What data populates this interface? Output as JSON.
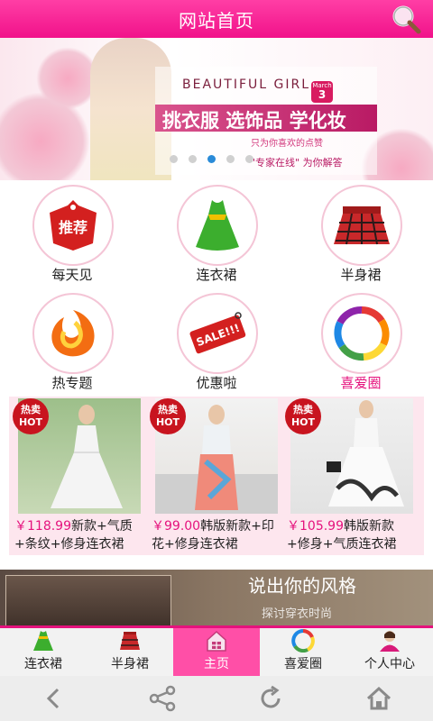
{
  "header": {
    "title": "网站首页",
    "search_icon": "search-icon"
  },
  "banner": {
    "heading": "BEAUTIFUL GIRL",
    "slogan": "挑衣服 选饰品 学化妆",
    "sub1": "只为你喜欢的点赞",
    "sub2": "\"专家在线\" 为你解答",
    "month": "March",
    "day": "3",
    "active_dot": 2
  },
  "categories": [
    {
      "label": "每天见",
      "icon": "recommend-tag-icon",
      "badge": "推荐"
    },
    {
      "label": "连衣裙",
      "icon": "dress-icon"
    },
    {
      "label": "半身裙",
      "icon": "skirt-icon"
    },
    {
      "label": "热专题",
      "icon": "hot-topic-icon"
    },
    {
      "label": "优惠啦",
      "icon": "sale-tag-icon",
      "badge": "SALE!!!"
    },
    {
      "label": "喜爱圈",
      "icon": "favorite-circle-icon",
      "highlight": true
    }
  ],
  "products": [
    {
      "hot": "热卖",
      "hot_en": "HOT",
      "price": "￥118.99",
      "title": "新款+气质+条纹+修身连衣裙"
    },
    {
      "hot": "热卖",
      "hot_en": "HOT",
      "price": "￥99.00",
      "title": "韩版新款+印花+修身连衣裙"
    },
    {
      "hot": "热卖",
      "hot_en": "HOT",
      "price": "￥105.99",
      "title": "韩版新款+修身+气质连衣裙"
    }
  ],
  "banner2": {
    "text": "说出你的风格",
    "subtext": "探讨穿衣时尚"
  },
  "tabs": [
    {
      "label": "连衣裙",
      "icon": "dress-icon"
    },
    {
      "label": "半身裙",
      "icon": "skirt-icon"
    },
    {
      "label": "主页",
      "icon": "home-icon",
      "active": true
    },
    {
      "label": "喜爱圈",
      "icon": "favorite-circle-icon"
    },
    {
      "label": "个人中心",
      "icon": "user-icon"
    }
  ],
  "system_nav": [
    "back-icon",
    "share-icon",
    "refresh-icon",
    "home-icon"
  ],
  "colors": {
    "brand": "#f1128a",
    "price": "#e5127d",
    "active_tab": "#ff4fa7"
  }
}
